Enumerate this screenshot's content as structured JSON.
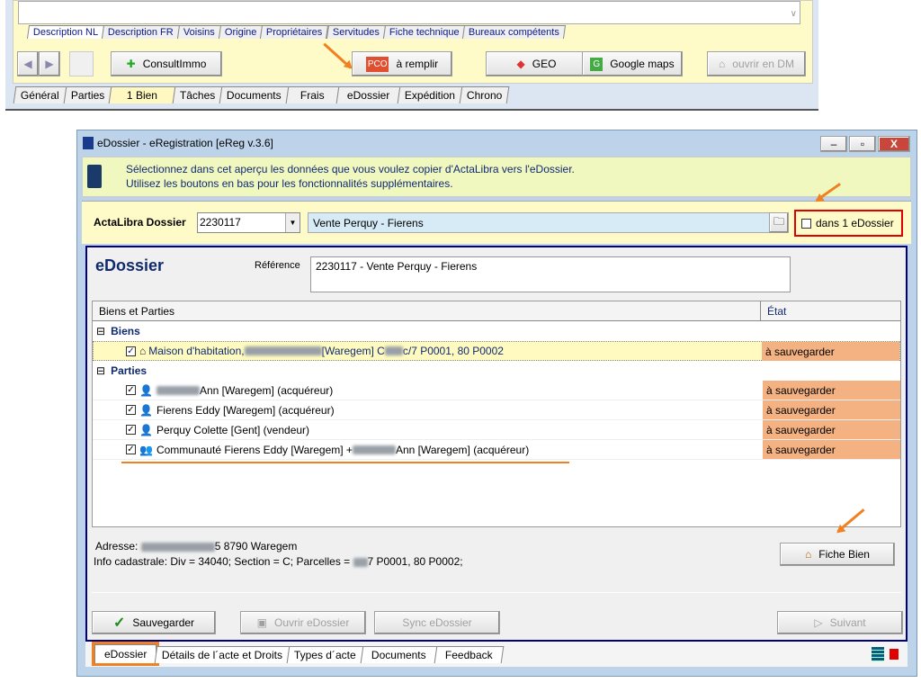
{
  "top_window": {
    "subtabs": [
      "Description NL",
      "Description FR",
      "Voisins",
      "Origine",
      "Propriétaires",
      "Servitudes",
      "Fiche technique",
      "Bureaux compétents"
    ],
    "buttons": {
      "consultimmo": "ConsultImmo",
      "pco_badge": "PCO",
      "a_remplir": "à remplir",
      "geo": "GEO",
      "google_maps": "Google maps",
      "ouvrir_dm": "ouvrir en DM"
    },
    "tabs": [
      "Général",
      "Parties",
      "1 Bien",
      "Tâches",
      "Documents",
      "Frais",
      "eDossier",
      "Expédition",
      "Chrono"
    ],
    "active_tab": "1 Bien"
  },
  "dialog": {
    "title": "eDossier - eRegistration [eReg v.3.6]",
    "info_line1": "Sélectionnez dans cet aperçu les données que vous voulez copier d'ActaLibra vers l'eDossier.",
    "info_line2": "Utilisez les boutons en bas pour les fonctionnalités supplémentaires.",
    "dossier_label": "ActaLibra Dossier",
    "dossier_number": "2230117",
    "dossier_name": "Vente Perquy - Fierens",
    "dans_edossier_label": "dans 1 eDossier",
    "dans_edossier_checked": false,
    "section_title": "eDossier",
    "reference_label": "Référence",
    "reference_value": "2230117 - Vente Perquy - Fierens",
    "table": {
      "columns": [
        "Biens et Parties",
        "État"
      ],
      "groups": [
        {
          "label": "Biens",
          "items": [
            {
              "pre": "Maison d'habitation, ",
              "mid": " [Waregem] C ",
              "post": "c/7 P0001, 80 P0002",
              "state": "à sauvegarder",
              "icon": "house-icon",
              "checked": true
            }
          ]
        },
        {
          "label": "Parties",
          "items": [
            {
              "pre": "",
              "mid": "",
              "post": " Ann [Waregem] (acquéreur)",
              "state": "à sauvegarder",
              "icon": "person-icon",
              "checked": true
            },
            {
              "pre": "Fierens Eddy [Waregem] (acquéreur)",
              "state": "à sauvegarder",
              "icon": "person-icon",
              "checked": true
            },
            {
              "pre": "Perquy Colette [Gent] (vendeur)",
              "state": "à sauvegarder",
              "icon": "person-icon",
              "checked": true
            },
            {
              "pre": "Communauté Fierens Eddy [Waregem] + ",
              "post": " Ann [Waregem] (acquéreur)",
              "state": "à sauvegarder",
              "icon": "people-icon",
              "checked": true
            }
          ]
        }
      ]
    },
    "details": {
      "adresse_label": "Adresse: ",
      "adresse_value": "5  8790 Waregem",
      "cadastre_pre": "Info cadastrale: Div = 34040; Section = C; Parcelles = ",
      "cadastre_post": "7 P0001, 80 P0002;"
    },
    "buttons": {
      "fiche_bien": "Fiche Bien",
      "sauvegarder": "Sauvegarder",
      "ouvrir": "Ouvrir eDossier",
      "sync": "Sync eDossier",
      "suivant": "Suivant"
    },
    "tabs": [
      "eDossier",
      "Détails de l´acte et Droits",
      "Types d´acte",
      "Documents",
      "Feedback"
    ],
    "active_tab": "eDossier"
  },
  "colors": {
    "accent_orange": "#f08020",
    "state_bg": "#f4b283",
    "highlight_red": "#e00000",
    "panel_border": "#000080"
  }
}
